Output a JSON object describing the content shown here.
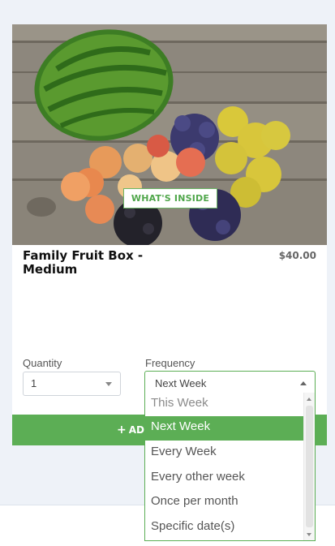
{
  "product": {
    "title": "Family Fruit Box - Medium",
    "price": "$40.00",
    "badge": "WHAT'S INSIDE",
    "image_icon": "fruit-photo"
  },
  "quantity": {
    "label": "Quantity",
    "value": "1"
  },
  "frequency": {
    "label": "Frequency",
    "value": "Next Week",
    "options": [
      "This Week",
      "Next Week",
      "Every Week",
      "Every other week",
      "Once per month",
      "Specific date(s)"
    ],
    "selected_index": 1
  },
  "add_button": {
    "plus": "+",
    "label": "AD"
  },
  "colors": {
    "accent": "#5cae55",
    "background": "#eef2f8"
  }
}
